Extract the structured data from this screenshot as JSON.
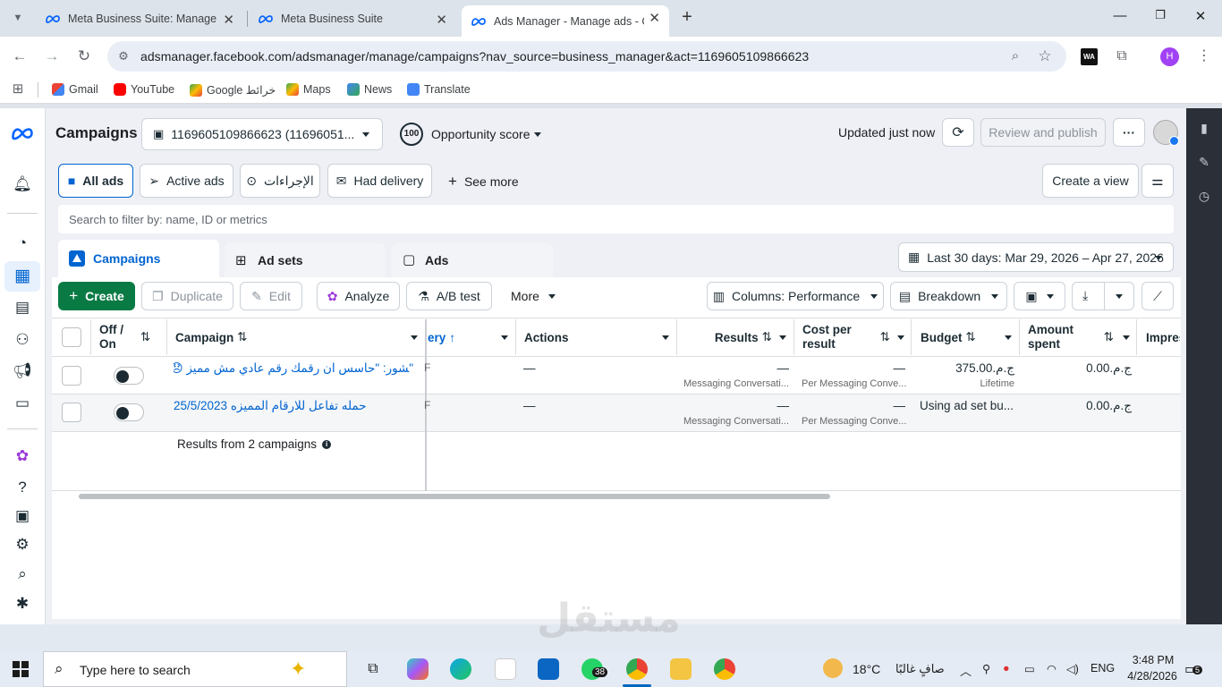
{
  "browser": {
    "tabs": [
      {
        "title": "Meta Business Suite: Manage Fa",
        "active": false
      },
      {
        "title": "Meta Business Suite",
        "active": false
      },
      {
        "title": "Ads Manager - Manage ads - C",
        "active": true
      }
    ],
    "url": "adsmanager.facebook.com/adsmanager/manage/campaigns?nav_source=business_manager&act=1169605109866623",
    "profile_initial": "H",
    "ext_label": "WA",
    "bookmarks": [
      "Gmail",
      "YouTube",
      "Google خرائط",
      "Maps",
      "News",
      "Translate"
    ]
  },
  "header": {
    "title": "Campaigns",
    "account": "1169605109866623 (11696051...",
    "opportunity_score": "100",
    "opportunity_label": "Opportunity score",
    "updated": "Updated just now",
    "review_publish": "Review and publish",
    "more": "···"
  },
  "filters": {
    "all_ads": "All ads",
    "active_ads": "Active ads",
    "actions_ar": "الإجراءات",
    "had_delivery": "Had delivery",
    "see_more": "See more",
    "create_view": "Create a view",
    "search_placeholder": "Search to filter by: name, ID or metrics"
  },
  "tabs": {
    "campaigns": "Campaigns",
    "ad_sets": "Ad sets",
    "ads": "Ads",
    "date_range": "Last 30 days: Mar 29, 2026 – Apr 27, 2026"
  },
  "actions": {
    "create": "Create",
    "duplicate": "Duplicate",
    "edit": "Edit",
    "analyze": "Analyze",
    "ab_test": "A/B test",
    "more": "More",
    "columns": "Columns: Performance",
    "breakdown": "Breakdown"
  },
  "table": {
    "columns": {
      "off_on": "Off / On",
      "campaign": "Campaign",
      "delivery": "ery",
      "actions": "Actions",
      "results": "Results",
      "cost_per_result": "Cost per result",
      "budget": "Budget",
      "amount_spent": "Amount spent",
      "impressions": "Impres"
    },
    "rows": [
      {
        "campaign": "\"ﺸﻮﺭ: \"ﺣﺎﺳﺲ ﺍﻥ ﺭﻗﻤﻚ ﺭﻗﻢ ﻋﺎﺩﻱ ﻣﺶ ﻣﻤﻴﺰ 😞❤️",
        "delivery": "F",
        "actions": "—",
        "results": "—",
        "results_sub": "Messaging Conversati...",
        "cost": "—",
        "cost_sub": "Per Messaging Conve...",
        "budget": "ج.م.375.00",
        "budget_sub": "Lifetime",
        "amount_spent": "ج.م.0.00"
      },
      {
        "campaign": "ﺣﻤﻠﻪ ﺗﻔﺎﻋﻞ ﻟﻼﺭﻗﺎﻡ ﺍﻟﻤﻤﻴﺰﻩ 25/5/2023",
        "delivery": "F",
        "actions": "—",
        "results": "—",
        "results_sub": "Messaging Conversati...",
        "cost": "—",
        "cost_sub": "Per Messaging Conve...",
        "budget": "Using ad set bu...",
        "budget_sub": "",
        "amount_spent": "ج.م.0.00"
      }
    ],
    "footer": "Results from 2 campaigns"
  },
  "taskbar": {
    "search_placeholder": "Type here to search",
    "weather": "18°C",
    "weather_desc": "صافٍ غالبًا",
    "lang": "ENG",
    "time": "3:48 PM",
    "date": "4/28/2026",
    "whatsapp_count": "38",
    "notif_count": "5"
  },
  "watermark": "مستقل"
}
